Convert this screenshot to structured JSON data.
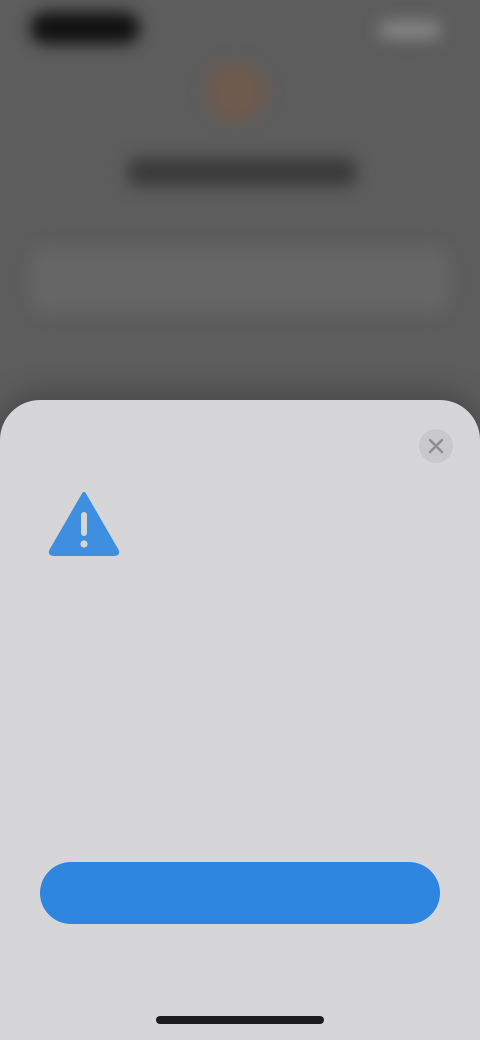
{
  "background_app": {
    "status_bar": {
      "time": "",
      "indicators": ""
    },
    "profile_name": "",
    "card_text": ""
  },
  "sheet": {
    "close_icon": "close-icon",
    "warning_icon": "warning-triangle-icon",
    "title": "",
    "message": "",
    "primary_button_label": "",
    "secondary_button_label": ""
  },
  "colors": {
    "sheet_background": "#d6d6d8",
    "accent": "#2f86e0",
    "scrim": "#5d5d5d"
  }
}
